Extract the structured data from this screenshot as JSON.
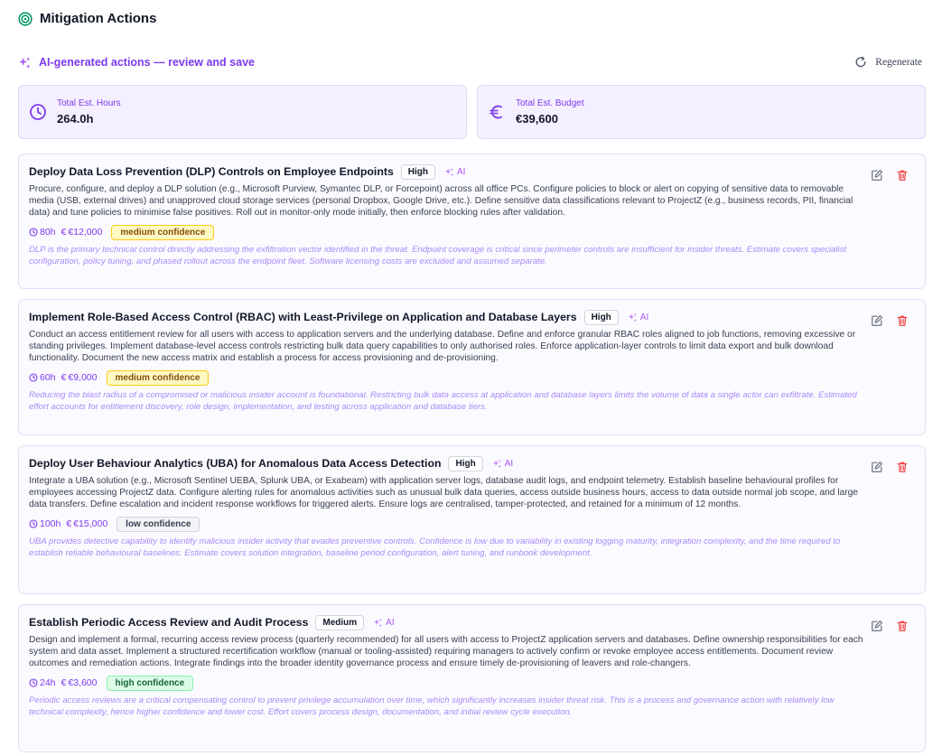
{
  "page": {
    "title": "Mitigation Actions"
  },
  "ai_bar": {
    "title": "AI-generated actions — review and save",
    "regenerate_label": "Regenerate"
  },
  "summary": {
    "hours": {
      "label": "Total Est. Hours",
      "value": "264.0h"
    },
    "budget": {
      "label": "Total Est. Budget",
      "value": "€39,600"
    }
  },
  "actions": [
    {
      "title": "Deploy Data Loss Prevention (DLP) Controls on Employee Endpoints",
      "priority": "High",
      "ai_label": "AI",
      "description": "Procure, configure, and deploy a DLP solution (e.g., Microsoft Purview, Symantec DLP, or Forcepoint) across all office PCs. Configure policies to block or alert on copying of sensitive data to removable media (USB, external drives) and unapproved cloud storage services (personal Dropbox, Google Drive, etc.). Define sensitive data classifications relevant to ProjectZ (e.g., business records, PII, financial data) and tune policies to minimise false positives. Roll out in monitor-only mode initially, then enforce blocking rules after validation.",
      "hours": "80h",
      "cost": "€12,000",
      "confidence": "medium confidence",
      "confidence_level": "medium",
      "rationale": "DLP is the primary technical control directly addressing the exfiltration vector identified in the threat. Endpoint coverage is critical since perimeter controls are insufficient for insider threats. Estimate covers specialist configuration, policy tuning, and phased rollout across the endpoint fleet. Software licensing costs are excluded and assumed separate."
    },
    {
      "title": "Implement Role-Based Access Control (RBAC) with Least-Privilege on Application and Database Layers",
      "priority": "High",
      "ai_label": "AI",
      "description": "Conduct an access entitlement review for all users with access to application servers and the underlying database. Define and enforce granular RBAC roles aligned to job functions, removing excessive or standing privileges. Implement database-level access controls restricting bulk data query capabilities to only authorised roles. Enforce application-layer controls to limit data export and bulk download functionality. Document the new access matrix and establish a process for access provisioning and de-provisioning.",
      "hours": "60h",
      "cost": "€9,000",
      "confidence": "medium confidence",
      "confidence_level": "medium",
      "rationale": "Reducing the blast radius of a compromised or malicious insider account is foundational. Restricting bulk data access at application and database layers limits the volume of data a single actor can exfiltrate. Estimated effort accounts for entitlement discovery, role design, implementation, and testing across application and database tiers."
    },
    {
      "title": "Deploy User Behaviour Analytics (UBA) for Anomalous Data Access Detection",
      "priority": "High",
      "ai_label": "AI",
      "description": "Integrate a UBA solution (e.g., Microsoft Sentinel UEBA, Splunk UBA, or Exabeam) with application server logs, database audit logs, and endpoint telemetry. Establish baseline behavioural profiles for employees accessing ProjectZ data. Configure alerting rules for anomalous activities such as unusual bulk data queries, access outside business hours, access to data outside normal job scope, and large data transfers. Define escalation and incident response workflows for triggered alerts. Ensure logs are centralised, tamper-protected, and retained for a minimum of 12 months.",
      "hours": "100h",
      "cost": "€15,000",
      "confidence": "low confidence",
      "confidence_level": "low",
      "rationale": "UBA provides detective capability to identify malicious insider activity that evades preventive controls. Confidence is low due to variability in existing logging maturity, integration complexity, and the time required to establish reliable behavioural baselines. Estimate covers solution integration, baseline period configuration, alert tuning, and runbook development."
    },
    {
      "title": "Establish Periodic Access Review and Audit Process",
      "priority": "Medium",
      "ai_label": "AI",
      "description": "Design and implement a formal, recurring access review process (quarterly recommended) for all users with access to ProjectZ application servers and databases. Define ownership responsibilities for each system and data asset. Implement a structured recertification workflow (manual or tooling-assisted) requiring managers to actively confirm or revoke employee access entitlements. Document review outcomes and remediation actions. Integrate findings into the broader identity governance process and ensure timely de-provisioning of leavers and role-changers.",
      "hours": "24h",
      "cost": "€3,600",
      "confidence": "high confidence",
      "confidence_level": "high",
      "rationale": "Periodic access reviews are a critical compensating control to prevent privilege accumulation over time, which significantly increases insider threat risk. This is a process and governance action with relatively low technical complexity, hence higher confidence and lower cost. Effort covers process design, documentation, and initial review cycle execution."
    }
  ],
  "colors": {
    "accent": "#7c3aed",
    "ai_pink": "#a855f7",
    "header_green": "#059669",
    "delete_red": "#ef4444"
  },
  "icons": {
    "header": "target-icon",
    "ai": "sparkles-icon",
    "regenerate": "refresh-icon",
    "hours": "clock-icon",
    "budget": "euro-icon",
    "edit": "edit-icon",
    "delete": "trash-icon"
  }
}
